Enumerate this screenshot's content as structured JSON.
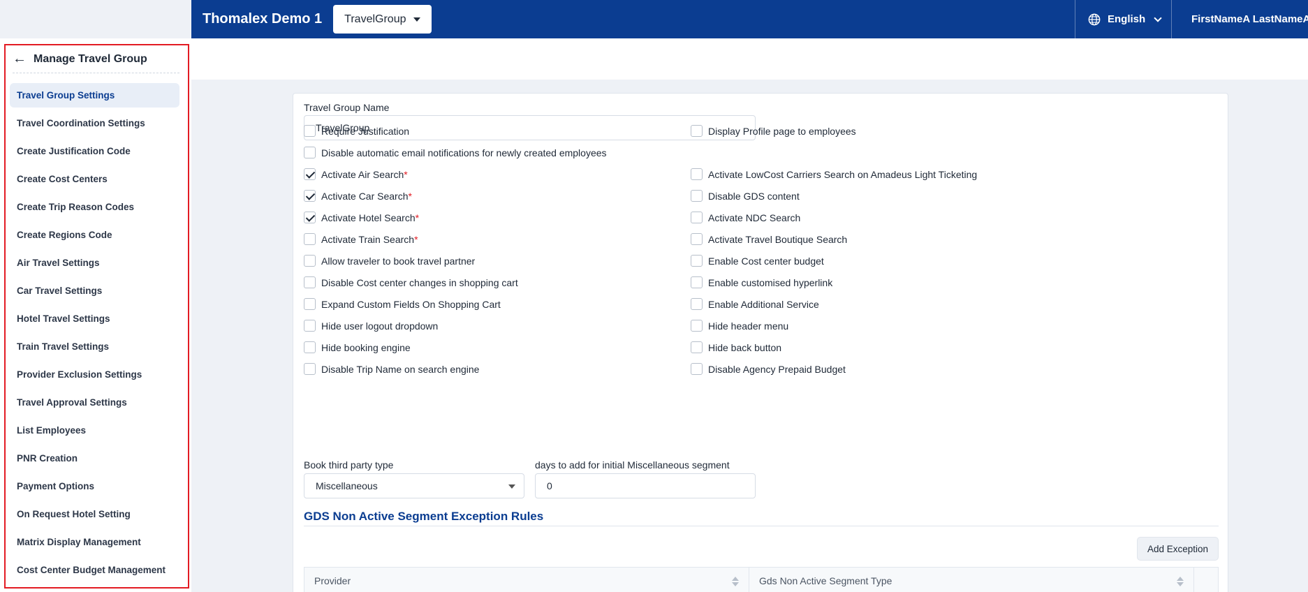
{
  "header": {
    "brand": "Thomalex Demo 1",
    "group_select": "TravelGroup",
    "language": "English",
    "user_name": "FirstNameA LastNameA",
    "colors": {
      "header_bg": "#0b3d91",
      "accent": "#0b3d91",
      "highlight_border": "#e31b23"
    }
  },
  "sidebar": {
    "title": "Manage Travel Group",
    "items": [
      {
        "label": "Travel Group Settings",
        "active": true
      },
      {
        "label": "Travel Coordination Settings"
      },
      {
        "label": "Create Justification Code"
      },
      {
        "label": "Create Cost Centers"
      },
      {
        "label": "Create Trip Reason Codes"
      },
      {
        "label": "Create Regions Code"
      },
      {
        "label": "Air Travel Settings"
      },
      {
        "label": "Car Travel Settings"
      },
      {
        "label": "Hotel Travel Settings"
      },
      {
        "label": "Train Travel Settings"
      },
      {
        "label": "Provider Exclusion Settings"
      },
      {
        "label": "Travel Approval Settings"
      },
      {
        "label": "List Employees"
      },
      {
        "label": "PNR Creation"
      },
      {
        "label": "Payment Options"
      },
      {
        "label": "On Request Hotel Setting"
      },
      {
        "label": "Matrix Display Management"
      },
      {
        "label": "Cost Center Budget Management"
      }
    ]
  },
  "form": {
    "name_label": "Travel Group Name",
    "name_value": "TravelGroup",
    "left_checks": [
      {
        "label": "Require Justification",
        "checked": false,
        "required": false
      },
      {
        "label": "Disable automatic email notifications for newly created employees",
        "checked": false,
        "required": false
      },
      {
        "label": "Activate Air Search",
        "checked": true,
        "required": true
      },
      {
        "label": "Activate Car Search",
        "checked": true,
        "required": true
      },
      {
        "label": "Activate Hotel Search",
        "checked": true,
        "required": true
      },
      {
        "label": "Activate Train Search",
        "checked": false,
        "required": true
      },
      {
        "label": "Allow traveler to book travel partner",
        "checked": false,
        "required": false
      },
      {
        "label": "Disable Cost center changes in shopping cart",
        "checked": false,
        "required": false
      },
      {
        "label": "Expand Custom Fields On Shopping Cart",
        "checked": false,
        "required": false
      },
      {
        "label": "Hide user logout dropdown",
        "checked": false,
        "required": false
      },
      {
        "label": "Hide booking engine",
        "checked": false,
        "required": false
      },
      {
        "label": "Disable Trip Name on search engine",
        "checked": false,
        "required": false
      }
    ],
    "right_checks": [
      {
        "label": "Display Profile page to employees",
        "checked": false
      },
      {
        "label": "Activate LowCost Carriers Search on Amadeus Light Ticketing",
        "checked": false
      },
      {
        "label": "Disable GDS content",
        "checked": false
      },
      {
        "label": "Activate NDC Search",
        "checked": false
      },
      {
        "label": "Activate Travel Boutique Search",
        "checked": false
      },
      {
        "label": "Enable Cost center budget",
        "checked": false
      },
      {
        "label": "Enable customised hyperlink",
        "checked": false
      },
      {
        "label": "Enable Additional Service",
        "checked": false
      },
      {
        "label": "Hide header menu",
        "checked": false
      },
      {
        "label": "Hide back button",
        "checked": false
      },
      {
        "label": "Disable Agency Prepaid Budget",
        "checked": false
      }
    ],
    "required_mark": "*",
    "third_party_label": "Book third party type",
    "third_party_value": "Miscellaneous",
    "days_label": "days to add for initial Miscellaneous segment",
    "days_value": "0"
  },
  "gds": {
    "title": "GDS Non Active Segment Exception Rules",
    "add_button": "Add Exception",
    "columns": [
      "Provider",
      "Gds Non Active Segment Type"
    ]
  }
}
